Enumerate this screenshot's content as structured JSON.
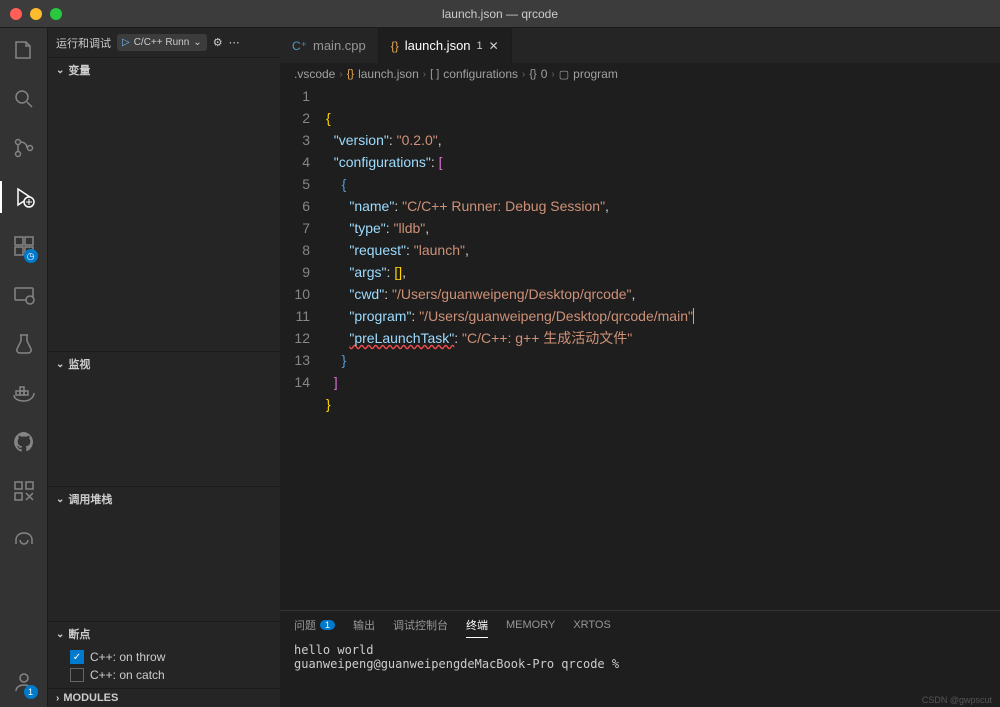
{
  "window": {
    "title": "launch.json — qrcode"
  },
  "activity_badge": "1",
  "sidebar": {
    "title": "运行和调试",
    "config": "C/C++ Runn",
    "sections": {
      "variables": "变量",
      "watch": "监视",
      "callstack": "调用堆栈",
      "breakpoints": "断点",
      "modules": "MODULES"
    },
    "breakpoints": {
      "on_throw": "C++: on throw",
      "on_catch": "C++: on catch"
    }
  },
  "tabs": {
    "main_cpp": "main.cpp",
    "launch_json": "launch.json",
    "modified": "1"
  },
  "breadcrumb": {
    "folder": ".vscode",
    "file": "launch.json",
    "array": "configurations",
    "index": "0",
    "field": "program"
  },
  "code": {
    "line_numbers": [
      "1",
      "2",
      "3",
      "4",
      "5",
      "6",
      "7",
      "8",
      "9",
      "10",
      "11",
      "12",
      "13",
      "14"
    ],
    "version_key": "\"version\"",
    "version_val": "\"0.2.0\"",
    "configurations_key": "\"configurations\"",
    "name_key": "\"name\"",
    "name_val": "\"C/C++ Runner: Debug Session\"",
    "type_key": "\"type\"",
    "type_val": "\"lldb\"",
    "request_key": "\"request\"",
    "request_val": "\"launch\"",
    "args_key": "\"args\"",
    "cwd_key": "\"cwd\"",
    "cwd_val": "\"/Users/guanweipeng/Desktop/qrcode\"",
    "program_key": "\"program\"",
    "program_val": "\"/Users/guanweipeng/Desktop/qrcode/main\"",
    "prelaunch_key": "\"preLaunchTask\"",
    "prelaunch_val": "\"C/C++: g++ 生成活动文件\""
  },
  "panel": {
    "tabs": {
      "problems": "问题",
      "problems_count": "1",
      "output": "输出",
      "debug_console": "调试控制台",
      "terminal": "终端",
      "memory": "MEMORY",
      "xrtos": "XRTOS"
    },
    "terminal_output": "hello world\nguanweipeng@guanweipengdeMacBook-Pro qrcode % "
  },
  "watermark": "CSDN @gwpscut"
}
